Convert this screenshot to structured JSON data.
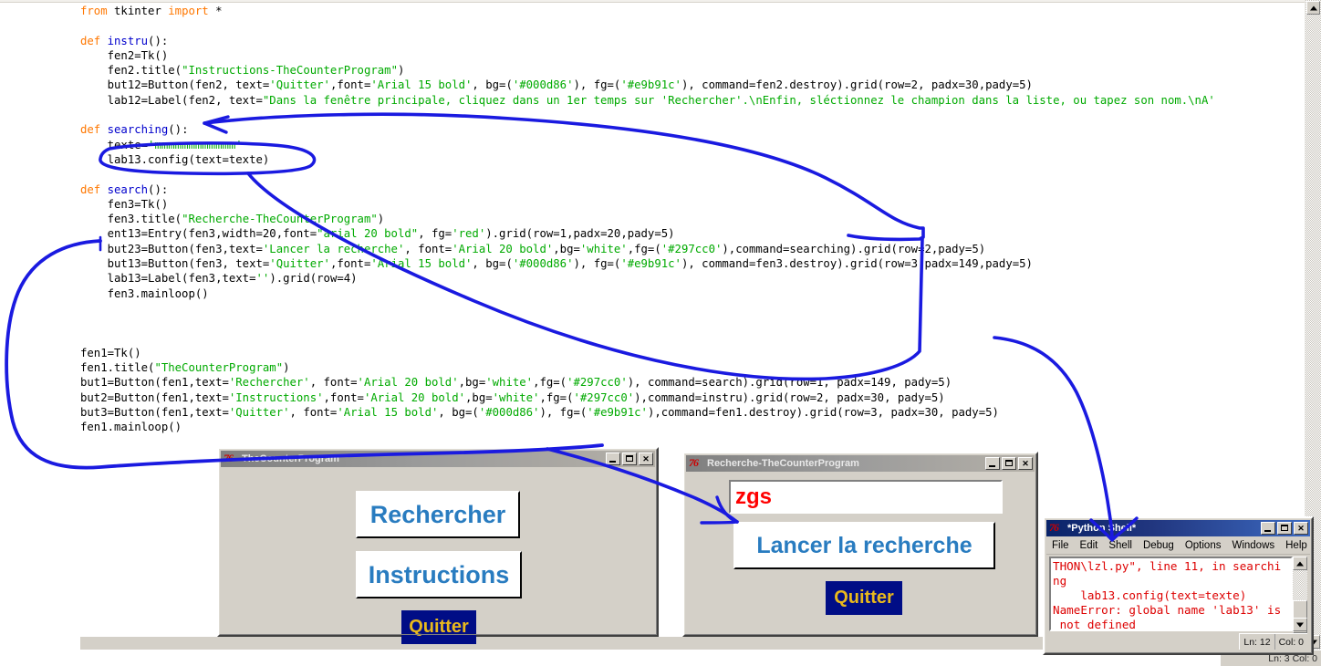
{
  "app": {
    "editor_status": "Ln: 3 Col: 0"
  },
  "code": {
    "lines": [
      [
        {
          "t": "from ",
          "c": "kw"
        },
        {
          "t": "tkinter ",
          "c": ""
        },
        {
          "t": "import ",
          "c": "kw"
        },
        {
          "t": "*",
          "c": ""
        }
      ],
      [],
      [
        {
          "t": "def ",
          "c": "kw"
        },
        {
          "t": "instru",
          "c": "fn"
        },
        {
          "t": "():",
          "c": ""
        }
      ],
      [
        {
          "t": "    fen2=Tk()",
          "c": ""
        }
      ],
      [
        {
          "t": "    fen2.title(",
          "c": ""
        },
        {
          "t": "\"Instructions-TheCounterProgram\"",
          "c": "str"
        },
        {
          "t": ")",
          "c": ""
        }
      ],
      [
        {
          "t": "    but12=Button(fen2, text=",
          "c": ""
        },
        {
          "t": "'Quitter'",
          "c": "str"
        },
        {
          "t": ",font=",
          "c": ""
        },
        {
          "t": "'Arial 15 bold'",
          "c": "str"
        },
        {
          "t": ", bg=(",
          "c": ""
        },
        {
          "t": "'#000d86'",
          "c": "str"
        },
        {
          "t": "), fg=(",
          "c": ""
        },
        {
          "t": "'#e9b91c'",
          "c": "str"
        },
        {
          "t": "), command=fen2.destroy).grid(row=2, padx=30,pady=5)",
          "c": ""
        }
      ],
      [
        {
          "t": "    lab12=Label(fen2, text=",
          "c": ""
        },
        {
          "t": "\"Dans la fenêtre principale, cliquez dans un 1er temps sur 'Rechercher'.\\nEnfin, sléctionnez le champion dans la liste, ou tapez son nom.\\nA'",
          "c": "str"
        }
      ],
      [],
      [
        {
          "t": "def ",
          "c": "kw"
        },
        {
          "t": "searching",
          "c": "fn"
        },
        {
          "t": "():",
          "c": ""
        }
      ],
      [
        {
          "t": "    texte=",
          "c": ""
        },
        {
          "t": "'mmmmmmmmmmmm'",
          "c": "str"
        }
      ],
      [
        {
          "t": "    lab13.config(text=texte)",
          "c": ""
        }
      ],
      [],
      [
        {
          "t": "def ",
          "c": "kw"
        },
        {
          "t": "search",
          "c": "fn"
        },
        {
          "t": "():",
          "c": ""
        }
      ],
      [
        {
          "t": "    fen3=Tk()",
          "c": ""
        }
      ],
      [
        {
          "t": "    fen3.title(",
          "c": ""
        },
        {
          "t": "\"Recherche-TheCounterProgram\"",
          "c": "str"
        },
        {
          "t": ")",
          "c": ""
        }
      ],
      [
        {
          "t": "    ent13=Entry(fen3,width=20,font=",
          "c": ""
        },
        {
          "t": "\"arial 20 bold\"",
          "c": "str"
        },
        {
          "t": ", fg=",
          "c": ""
        },
        {
          "t": "'red'",
          "c": "str"
        },
        {
          "t": ").grid(row=1,padx=20,pady=5)",
          "c": ""
        }
      ],
      [
        {
          "t": "    but23=Button(fen3,text=",
          "c": ""
        },
        {
          "t": "'Lancer la recherche'",
          "c": "str"
        },
        {
          "t": ", font=",
          "c": ""
        },
        {
          "t": "'Arial 20 bold'",
          "c": "str"
        },
        {
          "t": ",bg=",
          "c": ""
        },
        {
          "t": "'white'",
          "c": "str"
        },
        {
          "t": ",fg=(",
          "c": ""
        },
        {
          "t": "'#297cc0'",
          "c": "str"
        },
        {
          "t": "),command=searching).grid(row=2,pady=5)",
          "c": ""
        }
      ],
      [
        {
          "t": "    but13=Button(fen3, text=",
          "c": ""
        },
        {
          "t": "'Quitter'",
          "c": "str"
        },
        {
          "t": ",font=",
          "c": ""
        },
        {
          "t": "'Arial 15 bold'",
          "c": "str"
        },
        {
          "t": ", bg=(",
          "c": ""
        },
        {
          "t": "'#000d86'",
          "c": "str"
        },
        {
          "t": "), fg=(",
          "c": ""
        },
        {
          "t": "'#e9b91c'",
          "c": "str"
        },
        {
          "t": "), command=fen3.destroy).grid(row=3,padx=149,pady=5)",
          "c": ""
        }
      ],
      [
        {
          "t": "    lab13=Label(fen3,text=",
          "c": ""
        },
        {
          "t": "''",
          "c": "str"
        },
        {
          "t": ").grid(row=4)",
          "c": ""
        }
      ],
      [
        {
          "t": "    fen3.mainloop()",
          "c": ""
        }
      ],
      [],
      [],
      [],
      [
        {
          "t": "fen1=Tk()",
          "c": ""
        }
      ],
      [
        {
          "t": "fen1.title(",
          "c": ""
        },
        {
          "t": "\"TheCounterProgram\"",
          "c": "str"
        },
        {
          "t": ")",
          "c": ""
        }
      ],
      [
        {
          "t": "but1=Button(fen1,text=",
          "c": ""
        },
        {
          "t": "'Rechercher'",
          "c": "str"
        },
        {
          "t": ", font=",
          "c": ""
        },
        {
          "t": "'Arial 20 bold'",
          "c": "str"
        },
        {
          "t": ",bg=",
          "c": ""
        },
        {
          "t": "'white'",
          "c": "str"
        },
        {
          "t": ",fg=(",
          "c": ""
        },
        {
          "t": "'#297cc0'",
          "c": "str"
        },
        {
          "t": "), command=search).grid(row=1, padx=149, pady=5)",
          "c": ""
        }
      ],
      [
        {
          "t": "but2=Button(fen1,text=",
          "c": ""
        },
        {
          "t": "'Instructions'",
          "c": "str"
        },
        {
          "t": ",font=",
          "c": ""
        },
        {
          "t": "'Arial 20 bold'",
          "c": "str"
        },
        {
          "t": ",bg=",
          "c": ""
        },
        {
          "t": "'white'",
          "c": "str"
        },
        {
          "t": ",fg=(",
          "c": ""
        },
        {
          "t": "'#297cc0'",
          "c": "str"
        },
        {
          "t": "),command=instru).grid(row=2, padx=30, pady=5)",
          "c": ""
        }
      ],
      [
        {
          "t": "but3=Button(fen1,text=",
          "c": ""
        },
        {
          "t": "'Quitter'",
          "c": "str"
        },
        {
          "t": ", font=",
          "c": ""
        },
        {
          "t": "'Arial 15 bold'",
          "c": "str"
        },
        {
          "t": ", bg=(",
          "c": ""
        },
        {
          "t": "'#000d86'",
          "c": "str"
        },
        {
          "t": "), fg=(",
          "c": ""
        },
        {
          "t": "'#e9b91c'",
          "c": "str"
        },
        {
          "t": "),command=fen1.destroy).grid(row=3, padx=30, pady=5)",
          "c": ""
        }
      ],
      [
        {
          "t": "fen1.mainloop()",
          "c": ""
        }
      ]
    ]
  },
  "main_window": {
    "title": "TheCounterProgram",
    "buttons": {
      "search": "Rechercher",
      "instructions": "Instructions",
      "quit": "Quitter"
    },
    "controls": {
      "minimize": "_",
      "maximize": "□",
      "close": "✕"
    }
  },
  "search_window": {
    "title": "Recherche-TheCounterProgram",
    "entry_value": "zgs",
    "buttons": {
      "launch": "Lancer la recherche",
      "quit": "Quitter"
    },
    "controls": {
      "minimize": "_",
      "maximize": "□",
      "close": "✕"
    }
  },
  "shell_window": {
    "title": "*Python Shell*",
    "menu": [
      "File",
      "Edit",
      "Shell",
      "Debug",
      "Options",
      "Windows",
      "Help"
    ],
    "output": "THON\\lzl.py\", line 11, in searchi\nng\n    lab13.config(text=texte)\nNameError: global name 'lab13' is\n not defined",
    "status_ln": "Ln: 12",
    "status_col": "Col: 0",
    "controls": {
      "minimize": "_",
      "maximize": "□",
      "close": "✕"
    }
  },
  "annotations": {
    "ink_color": "#1a1ae0",
    "notes": [
      "arrow from lab13.config line to searching def",
      "oval circling lab13.config(text=texte)",
      "long curve to command=searching",
      "big loop around main program block to TheCounterProgram window",
      "arrow pointing to Lancer la recherche button",
      "arrow pointing down to Python Shell window"
    ]
  },
  "colors": {
    "keyword": "#ff7700",
    "function": "#0000cc",
    "string": "#00aa00",
    "error": "#dd0000",
    "tk_blue": "#297cc0",
    "tk_navy": "#000d86",
    "tk_gold": "#e9b91c",
    "entry_red": "#ff0000"
  }
}
